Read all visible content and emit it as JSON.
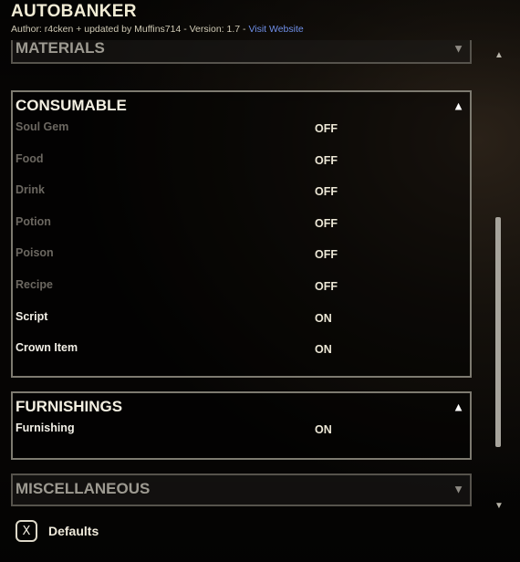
{
  "header": {
    "title": "AUTOBANKER",
    "author_text": "Author: r4cken + updated by Muffins714 - Version: 1.7 -",
    "website_link": "Visit Website"
  },
  "sections": {
    "materials": {
      "title": "MATERIALS",
      "arrow": "▼"
    },
    "consumable": {
      "title": "CONSUMABLE",
      "arrow": "▲",
      "rows": [
        {
          "label": "Soul Gem",
          "value": "OFF"
        },
        {
          "label": "Food",
          "value": "OFF"
        },
        {
          "label": "Drink",
          "value": "OFF"
        },
        {
          "label": "Potion",
          "value": "OFF"
        },
        {
          "label": "Poison",
          "value": "OFF"
        },
        {
          "label": "Recipe",
          "value": "OFF"
        },
        {
          "label": "Script",
          "value": "ON"
        },
        {
          "label": "Crown Item",
          "value": "ON"
        }
      ]
    },
    "furnishings": {
      "title": "FURNISHINGS",
      "arrow": "▲",
      "rows": [
        {
          "label": "Furnishing",
          "value": "ON"
        }
      ]
    },
    "miscellaneous": {
      "title": "MISCELLANEOUS",
      "arrow": "▼"
    }
  },
  "scrollbar": {
    "up": "▲",
    "down": "▼"
  },
  "footer": {
    "key": "X",
    "label": "Defaults"
  },
  "colors": {
    "link": "#6f8fe8",
    "enabled_text": "#f2efe6",
    "disabled_text": "#6b6760"
  }
}
